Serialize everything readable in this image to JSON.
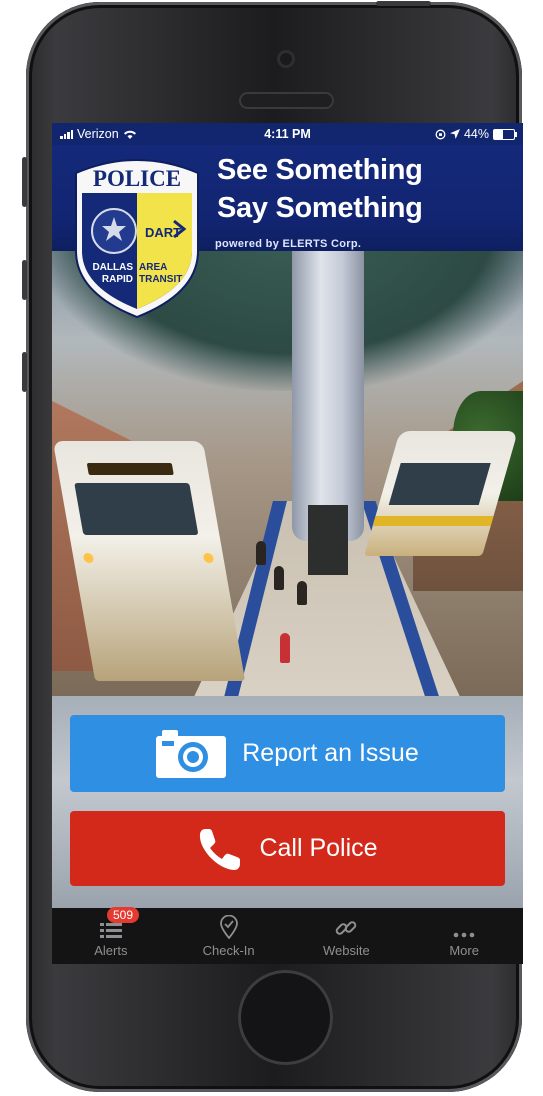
{
  "status_bar": {
    "carrier": "Verizon",
    "time": "4:11 PM",
    "battery": "44%",
    "battery_level": 0.44
  },
  "header": {
    "title_line1": "See Something",
    "title_line2": "Say Something",
    "powered_by": "powered by ELERTS Corp."
  },
  "logo": {
    "police": "POLICE",
    "dart": "DART",
    "line1_left": "DALLAS",
    "line1_right": "AREA",
    "line2_left": "RAPID",
    "line2_right": "TRANSIT"
  },
  "actions": {
    "report_label": "Report an Issue",
    "call_label": "Call Police"
  },
  "tabs": [
    {
      "label": "Alerts",
      "icon": "list-icon",
      "badge": "509"
    },
    {
      "label": "Check-In",
      "icon": "location-check-icon"
    },
    {
      "label": "Website",
      "icon": "link-icon"
    },
    {
      "label": "More",
      "icon": "more-dots-icon"
    }
  ],
  "colors": {
    "header_blue": "#14297a",
    "report_blue": "#2e8fe3",
    "call_red": "#d2291a",
    "badge_red": "#e53a30"
  }
}
